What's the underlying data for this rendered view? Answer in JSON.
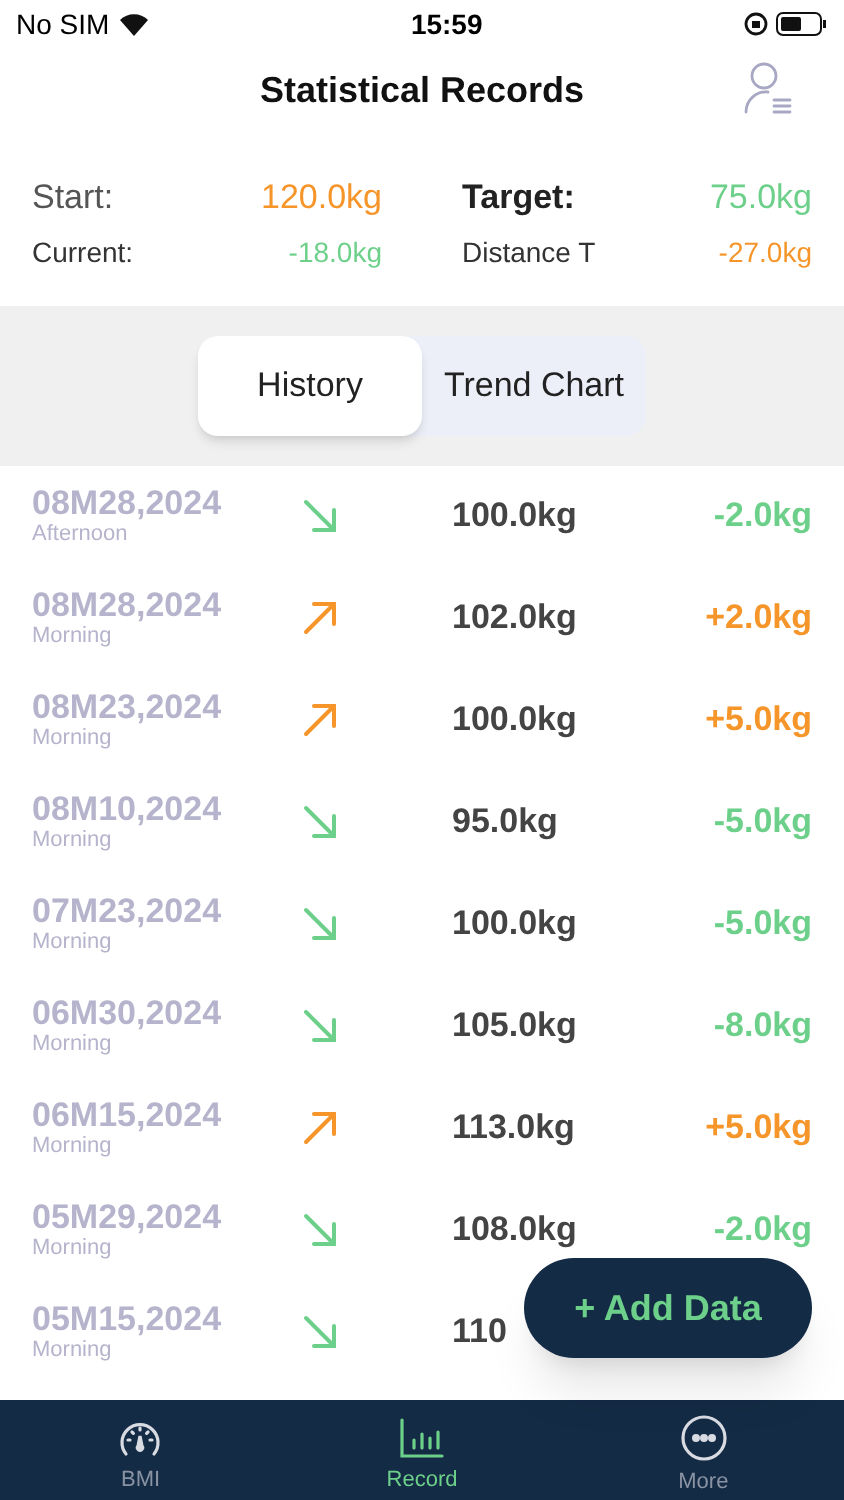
{
  "status_bar": {
    "carrier": "No SIM",
    "time": "15:59"
  },
  "header": {
    "title": "Statistical Records"
  },
  "summary": {
    "start_label": "Start:",
    "start_value": "120.0kg",
    "target_label": "Target:",
    "target_value": "75.0kg",
    "current_label": "Current:",
    "current_value": "-18.0kg",
    "distance_label": "Distance T",
    "distance_value": "-27.0kg"
  },
  "tabs": [
    {
      "label": "History",
      "selected": true
    },
    {
      "label": "Trend Chart",
      "selected": false
    }
  ],
  "records": [
    {
      "date": "08M28,2024",
      "period": "Afternoon",
      "kind": "down",
      "weight": "100.0kg",
      "change": "-2.0kg"
    },
    {
      "date": "08M28,2024",
      "period": "Morning",
      "kind": "up",
      "weight": "102.0kg",
      "change": "+2.0kg"
    },
    {
      "date": "08M23,2024",
      "period": "Morning",
      "kind": "up",
      "weight": "100.0kg",
      "change": "+5.0kg"
    },
    {
      "date": "08M10,2024",
      "period": "Morning",
      "kind": "down",
      "weight": "95.0kg",
      "change": "-5.0kg"
    },
    {
      "date": "07M23,2024",
      "period": "Morning",
      "kind": "down",
      "weight": "100.0kg",
      "change": "-5.0kg"
    },
    {
      "date": "06M30,2024",
      "period": "Morning",
      "kind": "down",
      "weight": "105.0kg",
      "change": "-8.0kg"
    },
    {
      "date": "06M15,2024",
      "period": "Morning",
      "kind": "up",
      "weight": "113.0kg",
      "change": "+5.0kg"
    },
    {
      "date": "05M29,2024",
      "period": "Morning",
      "kind": "down",
      "weight": "108.0kg",
      "change": "-2.0kg"
    },
    {
      "date": "05M15,2024",
      "period": "Morning",
      "kind": "down",
      "weight": "110"
    }
  ],
  "add_button": {
    "label": "+ Add Data"
  },
  "tab_bar": [
    {
      "label": "BMI",
      "kind": "gauge",
      "selected": false
    },
    {
      "label": "Record",
      "kind": "chart",
      "selected": true
    },
    {
      "label": "More",
      "kind": "more",
      "selected": false
    }
  ]
}
